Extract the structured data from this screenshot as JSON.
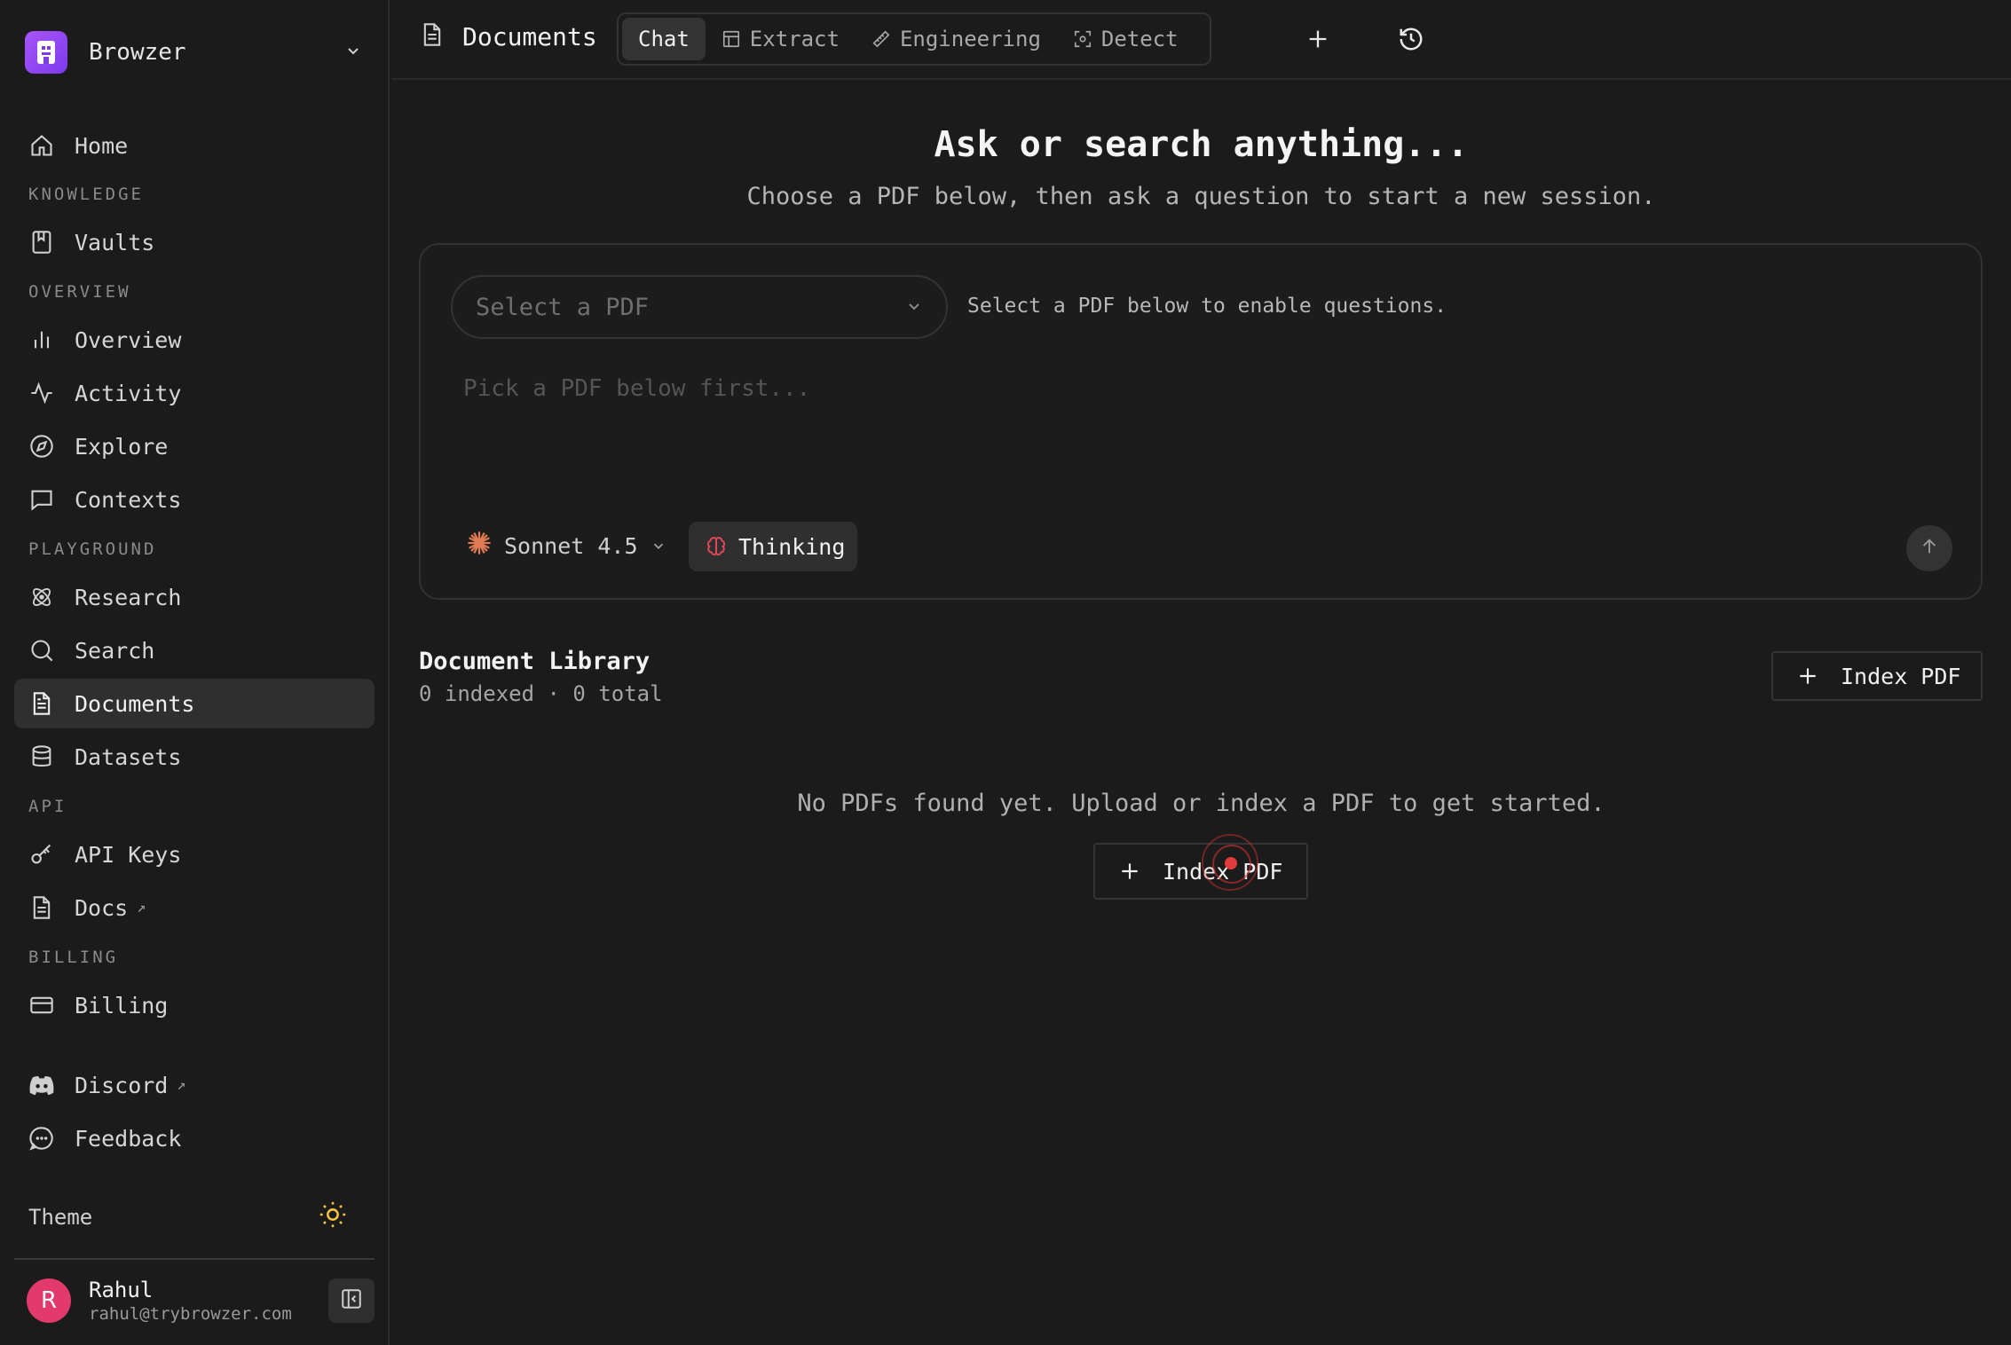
{
  "brand": {
    "name": "Browzer",
    "accent": "#8b5cf6"
  },
  "sidebar": {
    "home": "Home",
    "sections": {
      "knowledge": "KNOWLEDGE",
      "overview": "OVERVIEW",
      "playground": "PLAYGROUND",
      "api": "API",
      "billing": "BILLING"
    },
    "items": {
      "vaults": "Vaults",
      "overview": "Overview",
      "activity": "Activity",
      "explore": "Explore",
      "contexts": "Contexts",
      "research": "Research",
      "search": "Search",
      "documents": "Documents",
      "datasets": "Datasets",
      "api_keys": "API Keys",
      "docs": "Docs",
      "billing": "Billing",
      "discord": "Discord",
      "feedback": "Feedback"
    },
    "external_mark": "↗",
    "active_item": "documents",
    "theme_label": "Theme"
  },
  "user": {
    "initial": "R",
    "name": "Rahul",
    "email": "rahul@trybrowzer.com",
    "avatar_color": "#e23a6c"
  },
  "header": {
    "title": "Documents",
    "tabs": [
      {
        "label": "Chat",
        "icon": "none",
        "active": true
      },
      {
        "label": "Extract",
        "icon": "table-icon",
        "active": false
      },
      {
        "label": "Engineering",
        "icon": "ruler-icon",
        "active": false
      },
      {
        "label": "Detect",
        "icon": "scan-icon",
        "active": false
      }
    ]
  },
  "hero": {
    "title": "Ask or search anything...",
    "subtitle": "Choose a PDF below, then ask a question to start a new session."
  },
  "composer": {
    "pdf_select_placeholder": "Select a PDF",
    "select_hint": "Select a PDF below to enable questions.",
    "question_placeholder": "Pick a PDF below first...",
    "model": "Sonnet 4.5",
    "model_icon_color": "#e07b53",
    "thinking_label": "Thinking",
    "thinking_icon_color": "#e0485a"
  },
  "library": {
    "title": "Document Library",
    "summary": "0 indexed · 0 total",
    "index_button": "Index PDF",
    "empty_message": "No PDFs found yet. Upload or index a PDF to get started.",
    "empty_index_button": "Index PDF"
  }
}
